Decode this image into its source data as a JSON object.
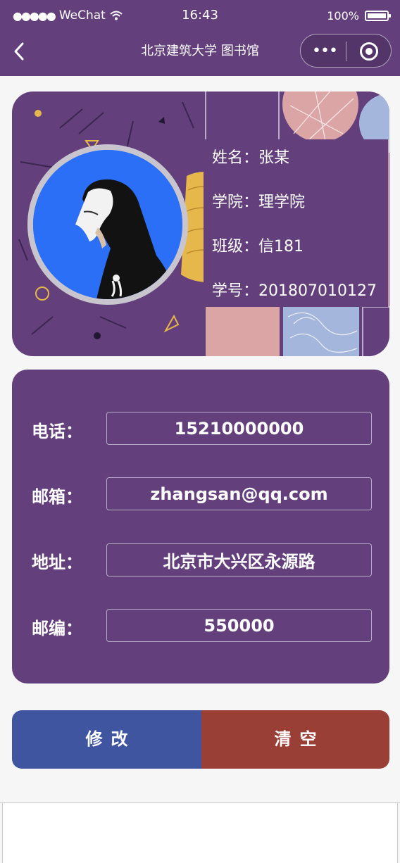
{
  "status_bar": {
    "signal": "●●●●●",
    "carrier": "WeChat",
    "time": "16:43",
    "battery": "100%"
  },
  "nav": {
    "title": "北京建筑大学 图书馆",
    "more_icon": "•••"
  },
  "profile": {
    "name_label": "姓名：",
    "name": "张某",
    "college_label": "学院：",
    "college": "理学院",
    "class_label": "班级：",
    "class": "信181",
    "id_label": "学号：",
    "student_id": "201807010127"
  },
  "contact": {
    "phone_label": "电话：",
    "phone": "15210000000",
    "email_label": "邮箱：",
    "email": "zhangsan@qq.com",
    "address_label": "地址：",
    "address": "北京市大兴区永源路",
    "zip_label": "邮编：",
    "zip": "550000"
  },
  "actions": {
    "edit_label": "修改",
    "clear_label": "清空"
  },
  "colors": {
    "primary": "#633f7c",
    "edit_button": "#3f55a0",
    "clear_button": "#9a3f35"
  }
}
